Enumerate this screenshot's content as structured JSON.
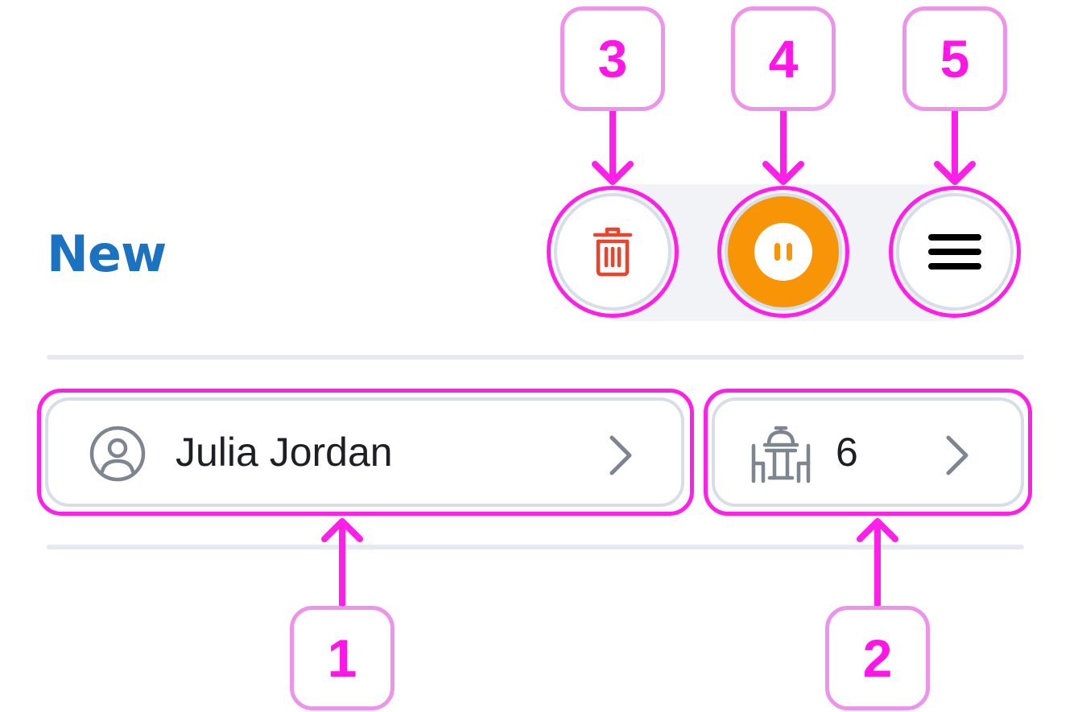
{
  "header": {
    "status_title": "New"
  },
  "actions": {
    "delete_icon": "trash-icon",
    "pause_icon": "pause-icon",
    "menu_icon": "hamburger-menu-icon",
    "accent_color": "#f79507",
    "delete_color": "#e9442c"
  },
  "guest": {
    "name": "Julia Jordan",
    "icon": "user-circle-icon"
  },
  "table": {
    "number": "6",
    "icon": "dining-table-icon"
  },
  "annotations": {
    "guest_field": "1",
    "table_field": "2",
    "delete_button": "3",
    "pause_button": "4",
    "menu_button": "5"
  }
}
